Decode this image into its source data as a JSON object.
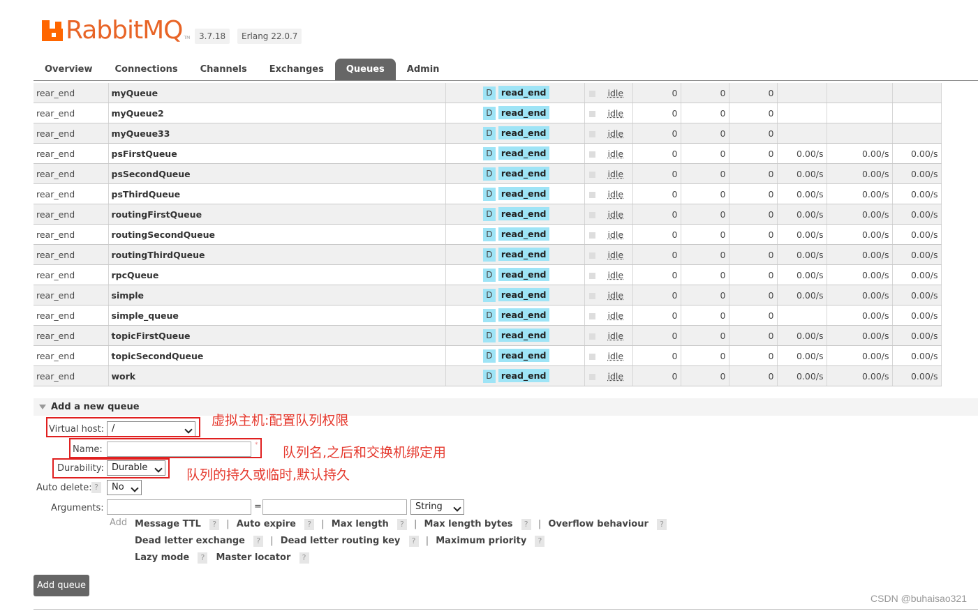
{
  "app": {
    "logo_part1": "RabbitMQ",
    "logo_tm": "TM",
    "version": "3.7.18",
    "erlang": "Erlang 22.0.7"
  },
  "tabs": [
    {
      "label": "Overview",
      "active": false
    },
    {
      "label": "Connections",
      "active": false
    },
    {
      "label": "Channels",
      "active": false
    },
    {
      "label": "Exchanges",
      "active": false
    },
    {
      "label": "Queues",
      "active": true
    },
    {
      "label": "Admin",
      "active": false
    }
  ],
  "queues": [
    {
      "vhost": "rear_end",
      "name": "myQueue",
      "features": "D",
      "policy": "read_end",
      "state": "idle",
      "ready": "0",
      "unacked": "0",
      "total": "0",
      "incoming": "",
      "deliver_get": "",
      "ack": ""
    },
    {
      "vhost": "rear_end",
      "name": "myQueue2",
      "features": "D",
      "policy": "read_end",
      "state": "idle",
      "ready": "0",
      "unacked": "0",
      "total": "0",
      "incoming": "",
      "deliver_get": "",
      "ack": ""
    },
    {
      "vhost": "rear_end",
      "name": "myQueue33",
      "features": "D",
      "policy": "read_end",
      "state": "idle",
      "ready": "0",
      "unacked": "0",
      "total": "0",
      "incoming": "",
      "deliver_get": "",
      "ack": ""
    },
    {
      "vhost": "rear_end",
      "name": "psFirstQueue",
      "features": "D",
      "policy": "read_end",
      "state": "idle",
      "ready": "0",
      "unacked": "0",
      "total": "0",
      "incoming": "0.00/s",
      "deliver_get": "0.00/s",
      "ack": "0.00/s"
    },
    {
      "vhost": "rear_end",
      "name": "psSecondQueue",
      "features": "D",
      "policy": "read_end",
      "state": "idle",
      "ready": "0",
      "unacked": "0",
      "total": "0",
      "incoming": "0.00/s",
      "deliver_get": "0.00/s",
      "ack": "0.00/s"
    },
    {
      "vhost": "rear_end",
      "name": "psThirdQueue",
      "features": "D",
      "policy": "read_end",
      "state": "idle",
      "ready": "0",
      "unacked": "0",
      "total": "0",
      "incoming": "0.00/s",
      "deliver_get": "0.00/s",
      "ack": "0.00/s"
    },
    {
      "vhost": "rear_end",
      "name": "routingFirstQueue",
      "features": "D",
      "policy": "read_end",
      "state": "idle",
      "ready": "0",
      "unacked": "0",
      "total": "0",
      "incoming": "0.00/s",
      "deliver_get": "0.00/s",
      "ack": "0.00/s"
    },
    {
      "vhost": "rear_end",
      "name": "routingSecondQueue",
      "features": "D",
      "policy": "read_end",
      "state": "idle",
      "ready": "0",
      "unacked": "0",
      "total": "0",
      "incoming": "0.00/s",
      "deliver_get": "0.00/s",
      "ack": "0.00/s"
    },
    {
      "vhost": "rear_end",
      "name": "routingThirdQueue",
      "features": "D",
      "policy": "read_end",
      "state": "idle",
      "ready": "0",
      "unacked": "0",
      "total": "0",
      "incoming": "0.00/s",
      "deliver_get": "0.00/s",
      "ack": "0.00/s"
    },
    {
      "vhost": "rear_end",
      "name": "rpcQueue",
      "features": "D",
      "policy": "read_end",
      "state": "idle",
      "ready": "0",
      "unacked": "0",
      "total": "0",
      "incoming": "0.00/s",
      "deliver_get": "0.00/s",
      "ack": "0.00/s"
    },
    {
      "vhost": "rear_end",
      "name": "simple",
      "features": "D",
      "policy": "read_end",
      "state": "idle",
      "ready": "0",
      "unacked": "0",
      "total": "0",
      "incoming": "0.00/s",
      "deliver_get": "0.00/s",
      "ack": "0.00/s"
    },
    {
      "vhost": "rear_end",
      "name": "simple_queue",
      "features": "D",
      "policy": "read_end",
      "state": "idle",
      "ready": "0",
      "unacked": "0",
      "total": "0",
      "incoming": "",
      "deliver_get": "0.00/s",
      "ack": "0.00/s"
    },
    {
      "vhost": "rear_end",
      "name": "topicFirstQueue",
      "features": "D",
      "policy": "read_end",
      "state": "idle",
      "ready": "0",
      "unacked": "0",
      "total": "0",
      "incoming": "0.00/s",
      "deliver_get": "0.00/s",
      "ack": "0.00/s"
    },
    {
      "vhost": "rear_end",
      "name": "topicSecondQueue",
      "features": "D",
      "policy": "read_end",
      "state": "idle",
      "ready": "0",
      "unacked": "0",
      "total": "0",
      "incoming": "0.00/s",
      "deliver_get": "0.00/s",
      "ack": "0.00/s"
    },
    {
      "vhost": "rear_end",
      "name": "work",
      "features": "D",
      "policy": "read_end",
      "state": "idle",
      "ready": "0",
      "unacked": "0",
      "total": "0",
      "incoming": "0.00/s",
      "deliver_get": "0.00/s",
      "ack": "0.00/s"
    }
  ],
  "add_queue": {
    "section_title": "Add a new queue",
    "virtual_host_label": "Virtual host:",
    "virtual_host_value": "/",
    "name_label": "Name:",
    "name_value": "",
    "required_mark": "*",
    "durability_label": "Durability:",
    "durability_value": "Durable",
    "auto_delete_label": "Auto delete:",
    "auto_delete_value": "No",
    "arguments_label": "Arguments:",
    "arg_equals": "=",
    "arg_type_value": "String",
    "add_label": "Add",
    "help_mark": "?",
    "arg_links_row1": [
      "Message TTL",
      "Auto expire",
      "Max length",
      "Max length bytes",
      "Overflow behaviour"
    ],
    "arg_links_row2": [
      "Dead letter exchange",
      "Dead letter routing key",
      "Maximum priority"
    ],
    "arg_links_row3": [
      "Lazy mode",
      "Master locator"
    ],
    "separator": "|",
    "button_label": "Add queue"
  },
  "annotations": {
    "virtual_host": "虚拟主机:配置队列权限",
    "name": "队列名,之后和交换机绑定用",
    "durability": "队列的持久或临时,默认持久",
    "color": "#e53a2f"
  },
  "watermark": "CSDN @buhaisao321"
}
